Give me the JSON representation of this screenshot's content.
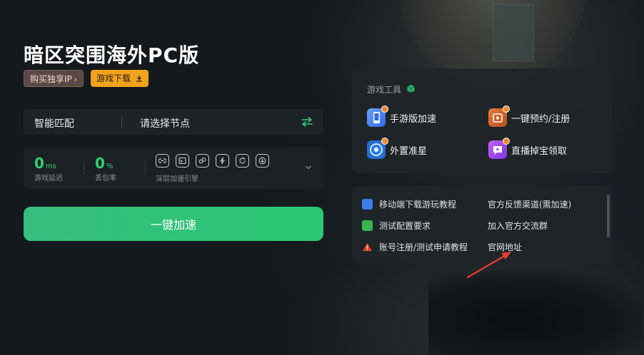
{
  "app": {
    "title": "暗区突围海外PC版",
    "buy_ip_label": "购买独享IP",
    "download_label": "游戏下载"
  },
  "node": {
    "mode": "智能匹配",
    "select_placeholder": "请选择节点"
  },
  "stats": {
    "delay_value": "0",
    "delay_unit": "ms",
    "delay_label": "游戏延迟",
    "loss_value": "0",
    "loss_unit": "%",
    "loss_label": "丢包率",
    "engine_label": "深层加速引擎",
    "engine_icons": [
      "link-icon",
      "terminal-icon",
      "nodes-icon",
      "bolt-icon",
      "refresh-icon",
      "download-circle-icon"
    ]
  },
  "accelerate_label": "一键加速",
  "tools": {
    "title": "游戏工具",
    "items": [
      {
        "label": "手游版加速",
        "icon": "mobile-icon"
      },
      {
        "label": "一键预约/注册",
        "icon": "reserve-icon"
      },
      {
        "label": "外置准星",
        "icon": "crosshair-icon"
      },
      {
        "label": "直播掉宝领取",
        "icon": "live-icon"
      }
    ]
  },
  "links": {
    "items": [
      "移动端下载游玩教程",
      "测试配置要求",
      "账号注册/测试申请教程",
      "官方反馈渠道(需加速)",
      "加入官方交流群",
      "官网地址"
    ]
  },
  "colors": {
    "accent_green": "#2fd174",
    "download_orange": "#f3a21b",
    "annotation_red": "#e8402a"
  }
}
